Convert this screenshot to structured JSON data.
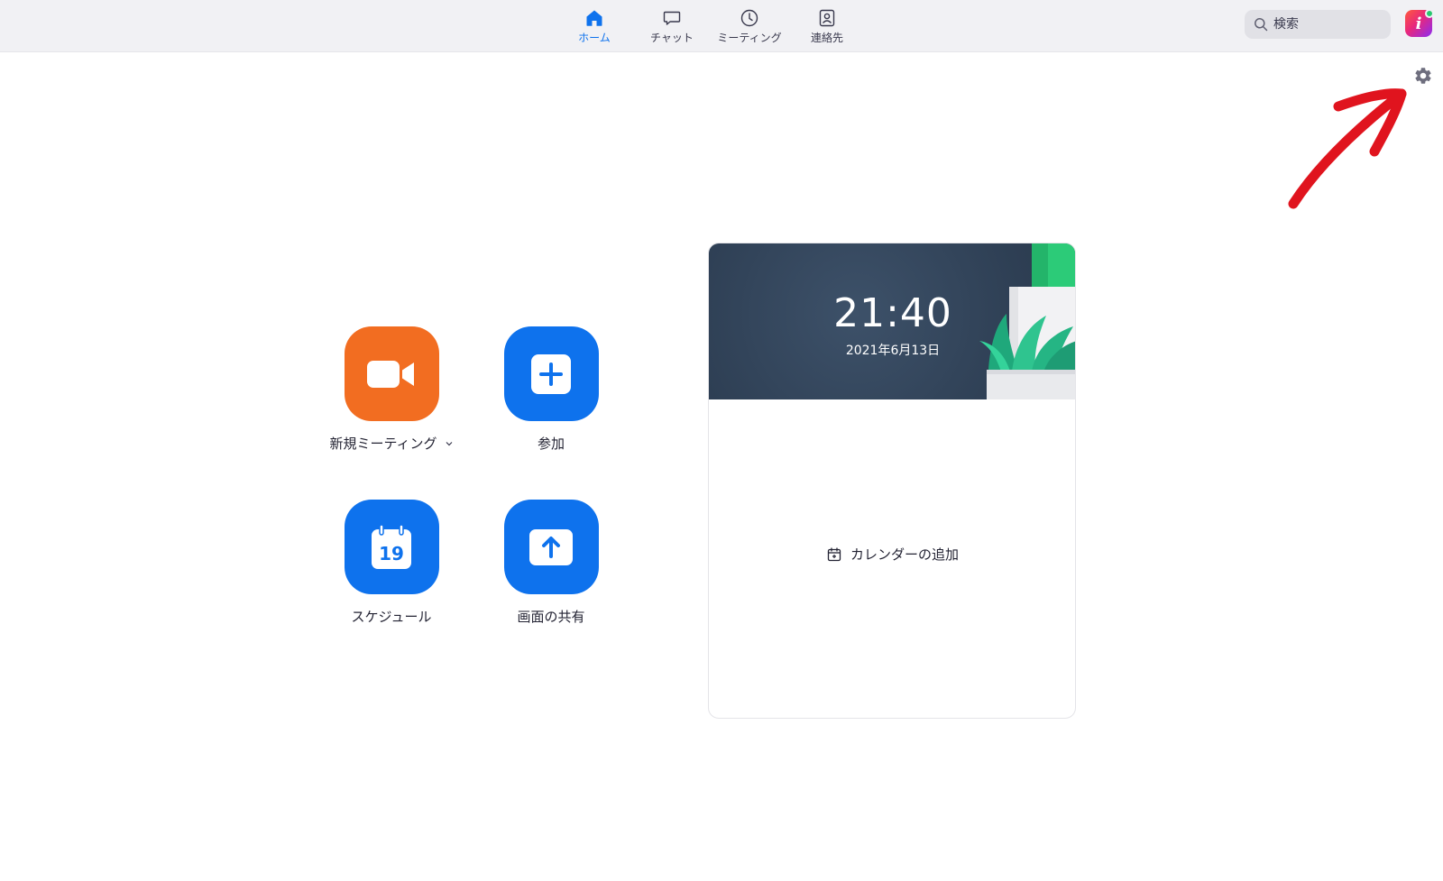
{
  "nav": {
    "items": [
      {
        "label": "ホーム",
        "icon": "home-icon",
        "active": true
      },
      {
        "label": "チャット",
        "icon": "chat-icon",
        "active": false
      },
      {
        "label": "ミーティング",
        "icon": "clock-icon",
        "active": false
      },
      {
        "label": "連絡先",
        "icon": "contacts-icon",
        "active": false
      }
    ]
  },
  "search": {
    "placeholder": "検索"
  },
  "avatar": {
    "initial": "i",
    "status": "online"
  },
  "actions": {
    "new_meeting": {
      "label": "新規ミーティング",
      "color": "#f26d21",
      "icon": "video-camera-icon"
    },
    "join": {
      "label": "参加",
      "color": "#0e72ed",
      "icon": "plus-icon"
    },
    "schedule": {
      "label": "スケジュール",
      "color": "#0e72ed",
      "icon": "calendar-icon",
      "icon_text": "19"
    },
    "share_screen": {
      "label": "画面の共有",
      "color": "#0e72ed",
      "icon": "upload-arrow-icon"
    }
  },
  "card": {
    "time": "21:40",
    "date": "2021年6月13日",
    "add_calendar": "カレンダーの追加"
  },
  "colors": {
    "accent": "#0e72ed",
    "orange": "#f26d21",
    "annotation": "#e0141e"
  }
}
